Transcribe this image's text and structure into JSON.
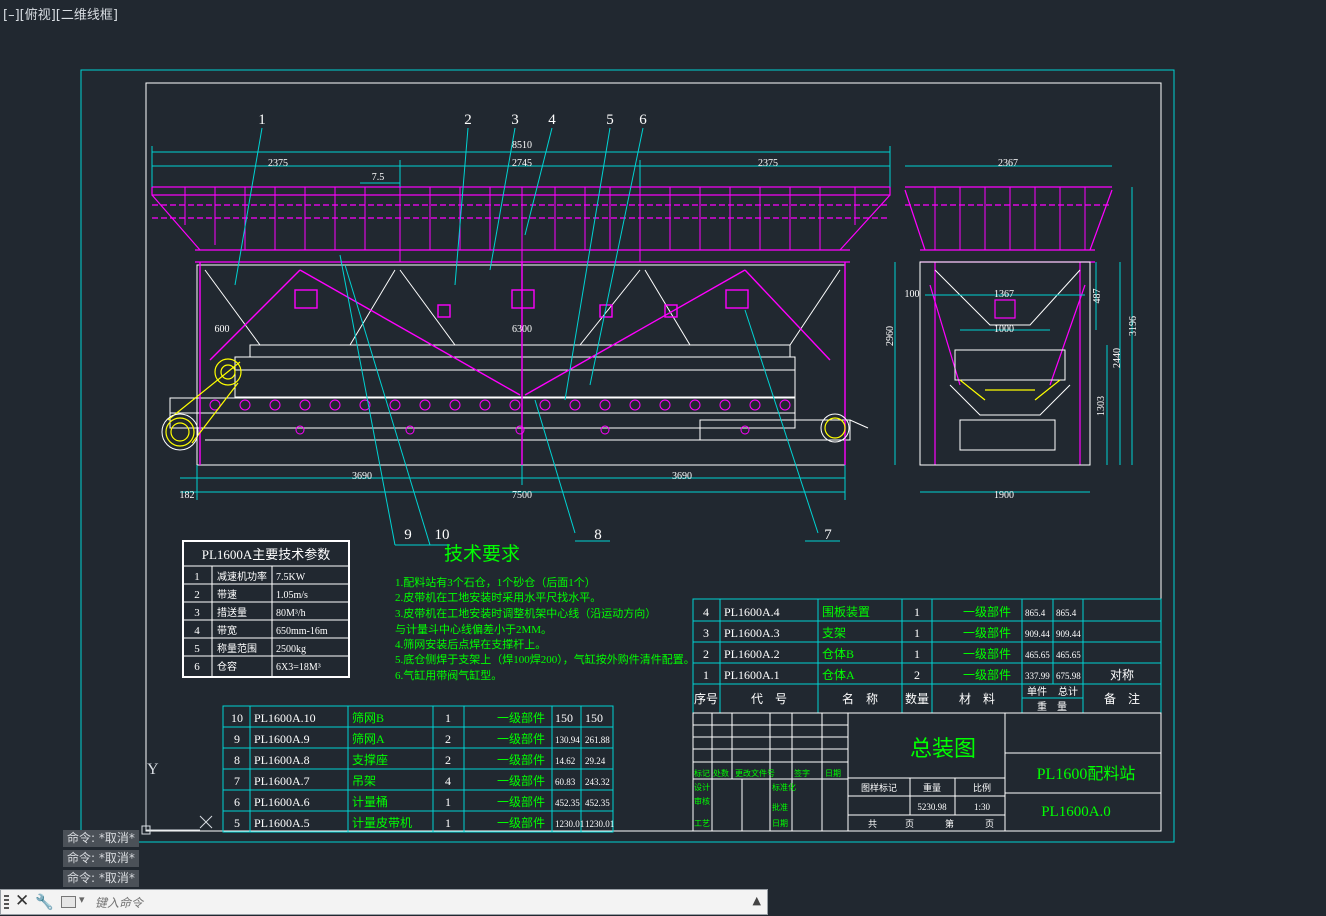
{
  "viewport_label": "[–][俯视][二维线框]",
  "ucs": {
    "y": "Y",
    "x": "X"
  },
  "dimensions": {
    "front": [
      "2375",
      "8510",
      "2745",
      "2375",
      "7.5",
      "600",
      "6300",
      "3690",
      "3690",
      "182",
      "7500"
    ],
    "side": [
      "2367",
      "100",
      "1367",
      "487",
      "1000",
      "2960",
      "2440",
      "3196",
      "1303",
      "1900"
    ]
  },
  "balloons": [
    "1",
    "2",
    "3",
    "4",
    "5",
    "6",
    "9",
    "10",
    "8",
    "7"
  ],
  "param_table": {
    "title": "PL1600A主要技术参数",
    "rows": [
      [
        "1",
        "减速机功率",
        "7.5KW"
      ],
      [
        "2",
        "带速",
        "1.05m/s"
      ],
      [
        "3",
        "措送量",
        "80M³/h"
      ],
      [
        "4",
        "带宽",
        "650mm-16m"
      ],
      [
        "5",
        "称量范围",
        "2500kg"
      ],
      [
        "6",
        "仓容",
        "6X3=18M³"
      ]
    ]
  },
  "tech_req": {
    "title": "技术要求",
    "lines": [
      "1.配料站有3个石仓，1个砂仓（后面1个）",
      "2.皮带机在工地安装时采用水平尺找水平。",
      "3.皮带机在工地安装时调整机架中心线（沿运动方向）",
      "与计量斗中心线偏差小于2MM。",
      "4.筛网安装后点焊在支撑杆上。",
      "5.底仓侧焊于支架上（焊100焊200），气缸按外购件清件配置。",
      "6.气缸用带阀气缸型。"
    ]
  },
  "parts_left": [
    [
      "10",
      "PL1600A.10",
      "筛网B",
      "1",
      "一级部件",
      "150",
      "150"
    ],
    [
      "9",
      "PL1600A.9",
      "筛网A",
      "2",
      "一级部件",
      "130.94",
      "261.88"
    ],
    [
      "8",
      "PL1600A.8",
      "支撑座",
      "2",
      "一级部件",
      "14.62",
      "29.24"
    ],
    [
      "7",
      "PL1600A.7",
      "吊架",
      "4",
      "一级部件",
      "60.83",
      "243.32"
    ],
    [
      "6",
      "PL1600A.6",
      "计量桶",
      "1",
      "一级部件",
      "452.35",
      "452.35"
    ],
    [
      "5",
      "PL1600A.5",
      "计量皮带机",
      "1",
      "一级部件",
      "1230.01",
      "1230.01"
    ]
  ],
  "parts_right": [
    [
      "4",
      "PL1600A.4",
      "围板装置",
      "1",
      "一级部件",
      "865.4",
      "865.4",
      ""
    ],
    [
      "3",
      "PL1600A.3",
      "支架",
      "1",
      "一级部件",
      "909.44",
      "909.44",
      ""
    ],
    [
      "2",
      "PL1600A.2",
      "仓体B",
      "1",
      "一级部件",
      "465.65",
      "465.65",
      ""
    ],
    [
      "1",
      "PL1600A.1",
      "仓体A",
      "2",
      "一级部件",
      "337.99",
      "675.98",
      "对称"
    ]
  ],
  "parts_header": [
    "序号",
    "代　号",
    "名　称",
    "数量",
    "材　料",
    "单件",
    "总计",
    "备　注",
    "重　量"
  ],
  "title_block": {
    "drawing_title": "总装图",
    "product": "PL1600配料站",
    "code": "PL1600A.0",
    "row_labels": [
      "标记",
      "处数",
      "更改文件号",
      "签字",
      "日期"
    ],
    "left_labels": [
      "设计",
      "审核",
      "工艺"
    ],
    "mid_labels": [
      "标准化",
      "批准",
      "日期"
    ],
    "stage_label": "图样标记",
    "weight_label": "重量",
    "scale_label": "比例",
    "weight": "5230.98",
    "scale": "1:30",
    "total_label": "共",
    "page_label": "页",
    "sheet_label": "第",
    "sheet_page": "页"
  },
  "command_history": [
    "命令: *取消*",
    "命令: *取消*",
    "命令: *取消*"
  ],
  "command_input": {
    "placeholder": "键入命令"
  },
  "icons": {
    "close": "close-icon",
    "wrench": "wrench-icon",
    "prompt": "command-prompt-icon",
    "dropdown": "chevron-down-icon",
    "up": "chevron-up-icon"
  },
  "colors": {
    "background": "#212830",
    "frame": "#00d2d2",
    "border": "#ffffff",
    "structure": "#ff00ff",
    "annotation": "#00ff00",
    "text_yellow": "#ffff00"
  }
}
